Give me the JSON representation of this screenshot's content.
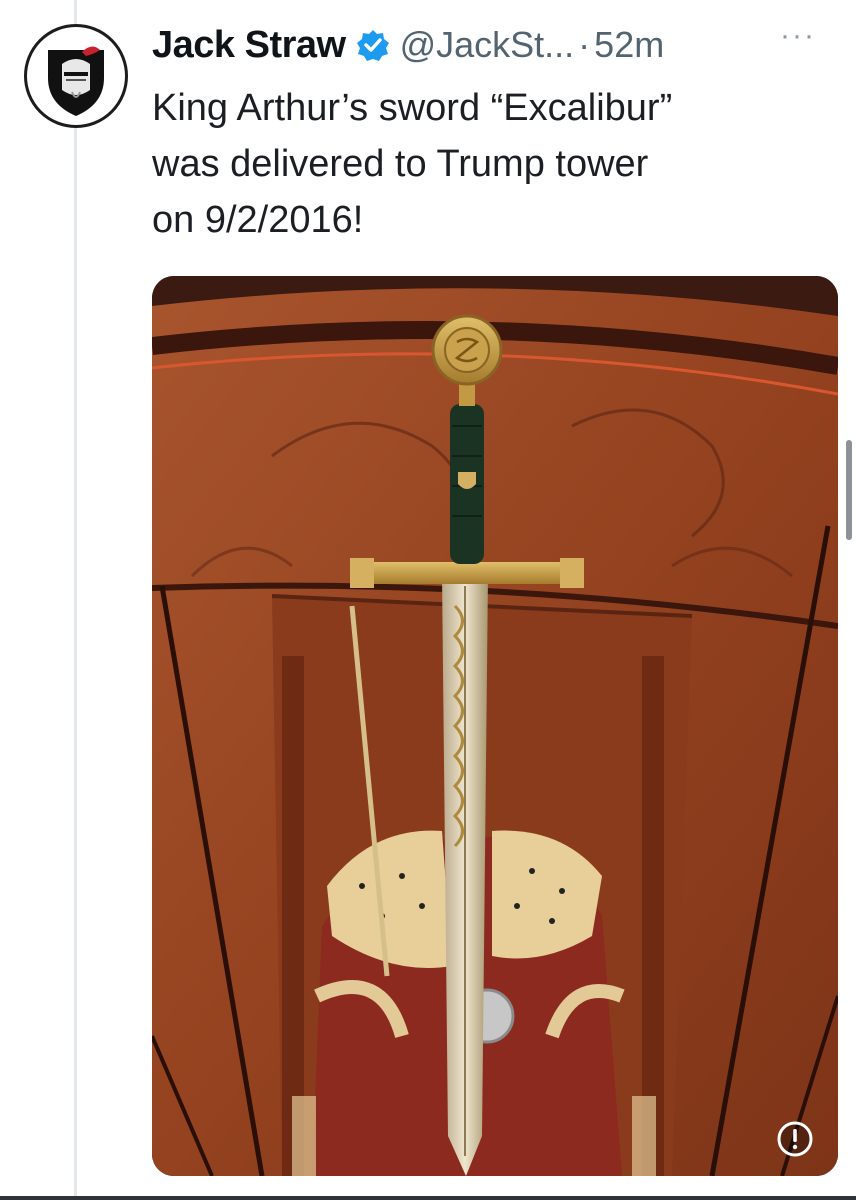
{
  "tweet": {
    "author_name": "Jack Straw",
    "handle": "@JackSt...",
    "separator": "·",
    "time_ago": "52m",
    "more_label": "···",
    "text_lines": [
      "King Arthur’s sword “Excalibur”",
      "was delivered to Trump tower",
      "on 9/2/2016!"
    ],
    "verified_icon": "verified-badge-icon",
    "alert_icon": "exclamation-circle-icon"
  },
  "colors": {
    "verified_blue": "#1d9bf0",
    "secondary_text": "#536471",
    "media_wood": "#9a4a28",
    "sword_gold": "#c9a04a"
  }
}
